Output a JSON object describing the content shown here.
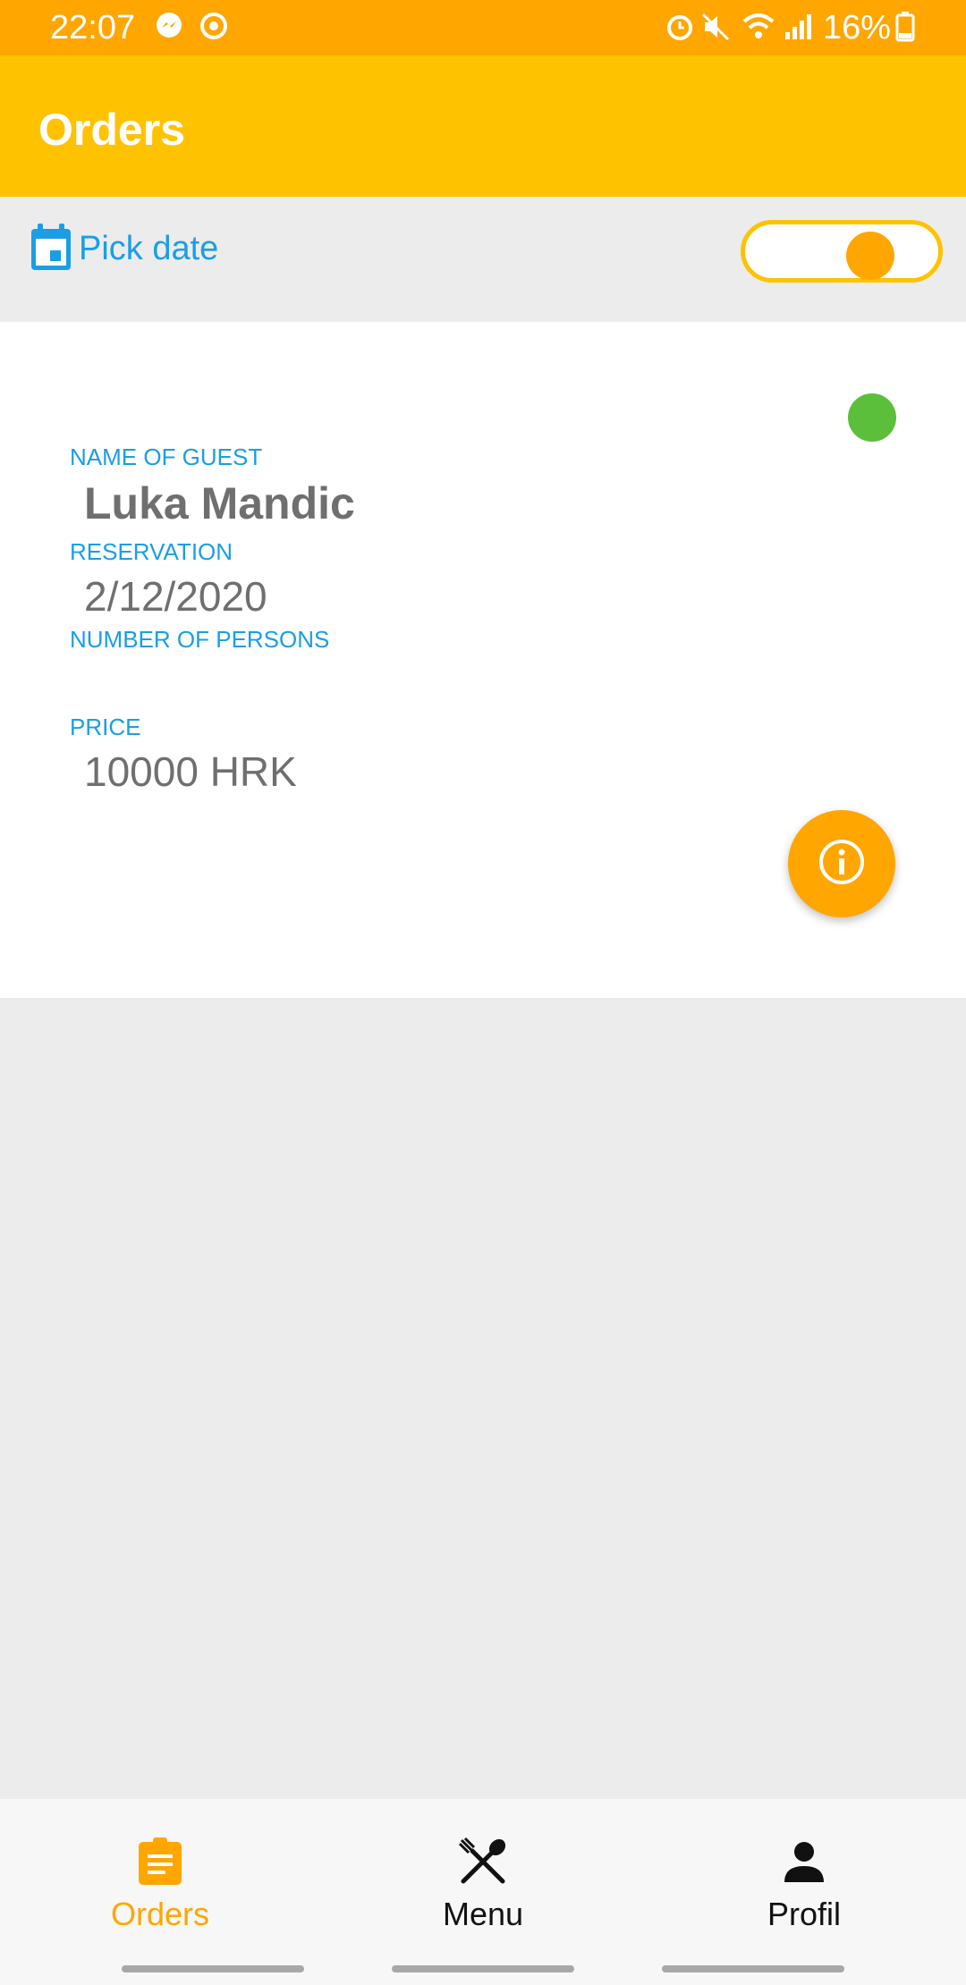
{
  "status_bar": {
    "time": "22:07",
    "battery": "16%",
    "left_icons": [
      "messenger-icon",
      "sync-icon"
    ],
    "right_icons": [
      "alarm-icon",
      "mute-icon",
      "wifi-icon",
      "signal-icon",
      "battery-icon"
    ]
  },
  "app_bar": {
    "title": "Orders"
  },
  "filter": {
    "pick_date_label": "Pick date",
    "toggle_on": true
  },
  "order": {
    "status_color": "#5cbf3c",
    "guest_label": "NAME OF GUEST",
    "guest_name": "Luka Mandic",
    "reservation_label": "RESERVATION",
    "reservation_date": "2/12/2020",
    "persons_label": "NUMBER OF PERSONS",
    "persons_value": "",
    "price_label": "PRICE",
    "price_value": "10000 HRK"
  },
  "bottom_nav": {
    "items": [
      {
        "label": "Orders",
        "icon": "clipboard-icon",
        "active": true
      },
      {
        "label": "Menu",
        "icon": "utensils-icon",
        "active": false
      },
      {
        "label": "Profil",
        "icon": "person-icon",
        "active": false
      }
    ]
  },
  "colors": {
    "accent": "#ffa600",
    "app_bar": "#ffc200",
    "label_blue": "#1a9ee6",
    "status_ok": "#5cbf3c"
  }
}
